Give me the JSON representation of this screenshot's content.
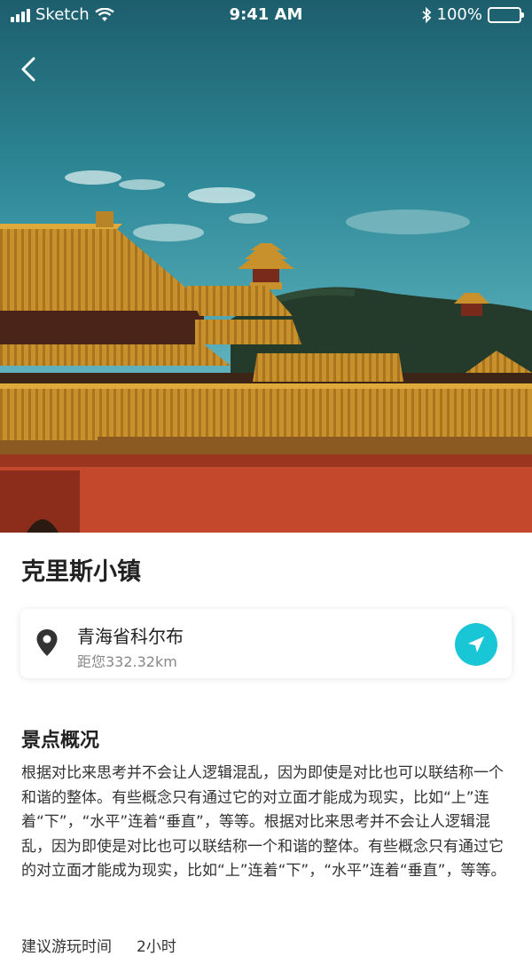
{
  "status_bar": {
    "carrier": "Sketch",
    "time": "9:41 AM",
    "battery": "100%"
  },
  "header": {
    "back_icon": "chevron-left-icon"
  },
  "place": {
    "title": "克里斯小镇"
  },
  "location": {
    "name": "青海省科尔布",
    "distance": "距您332.32km",
    "pin_icon": "map-pin-icon",
    "nav_icon": "navigation-arrow-icon",
    "accent_color": "#19c6d6"
  },
  "overview": {
    "title": "景点概况",
    "body": "根据对比来思考并不会让人逻辑混乱，因为即使是对比也可以联结称一个和谐的整体。有些概念只有通过它的对立面才能成为现实，比如“上”连着“下”，“水平”连着“垂直”，等等。根据对比来思考并不会让人逻辑混乱，因为即使是对比也可以联结称一个和谐的整体。有些概念只有通过它的对立面才能成为现实，比如“上”连着“下”，“水平”连着“垂直”，等等。"
  },
  "suggested_time": {
    "label": "建议游玩时间",
    "value": "2小时"
  }
}
